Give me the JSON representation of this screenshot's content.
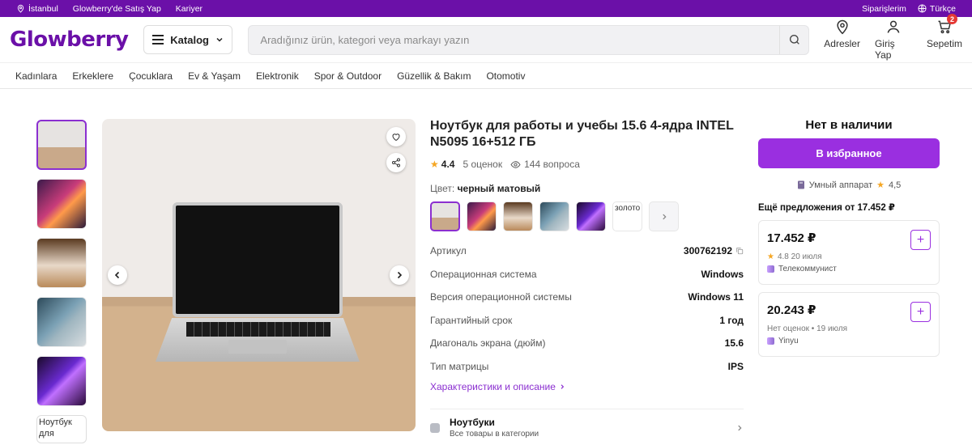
{
  "topbar": {
    "location": "İstanbul",
    "sell": "Glowberry'de Satış Yap",
    "career": "Kariyer",
    "orders": "Siparişlerim",
    "language": "Türkçe"
  },
  "header": {
    "logo": "Glowberry",
    "catalog": "Katalog",
    "search_placeholder": "Aradığınız ürün, kategori veya markayı yazın",
    "addresses": "Adresler",
    "login": "Giriş Yap",
    "cart": "Sepetim",
    "cart_count": "2"
  },
  "nav": [
    "Kadınlara",
    "Erkeklere",
    "Çocuklara",
    "Ev & Yaşam",
    "Elektronik",
    "Spor & Outdoor",
    "Güzellik & Bakım",
    "Otomotiv"
  ],
  "gallery": {
    "broken_thumb_alt": "Ноутбук для"
  },
  "product": {
    "title": "Ноутбук для работы и учебы 15.6 4-ядра INTEL N5095 16+512 ГБ",
    "rating": "4.4",
    "reviews": "5 оценок",
    "questions": "144 вопроса",
    "color_label": "Цвет:",
    "color_value": "черный матовый",
    "broken_swatch_alt": "золото",
    "specs": [
      {
        "k": "Артикул",
        "v": "300762192"
      },
      {
        "k": "Операционная система",
        "v": "Windows"
      },
      {
        "k": "Версия операционной системы",
        "v": "Windows 11"
      },
      {
        "k": "Гарантийный срок",
        "v": "1 год"
      },
      {
        "k": "Диагональ экрана (дюйм)",
        "v": "15.6"
      },
      {
        "k": "Тип матрицы",
        "v": "IPS"
      }
    ],
    "more_link": "Характеристики и описание",
    "category": {
      "name": "Ноутбуки",
      "sub": "Все товары в категории"
    }
  },
  "sidebar": {
    "stock": "Нет в наличии",
    "favorite_button": "В избранное",
    "store_name": "Умный аппарат",
    "store_rating": "4,5",
    "offers_title": "Ещё предложения от 17.452 ₽",
    "offers": [
      {
        "price": "17.452 ₽",
        "meta": "4.8 20 июля",
        "has_star": true,
        "seller": "Телекоммунист"
      },
      {
        "price": "20.243 ₽",
        "meta": "Нет оценок • 19 июля",
        "has_star": false,
        "seller": "Yinyu"
      }
    ]
  },
  "colors": {
    "brand": "#6b10a8",
    "accent": "#9a2fe0",
    "star": "#f5a623"
  }
}
